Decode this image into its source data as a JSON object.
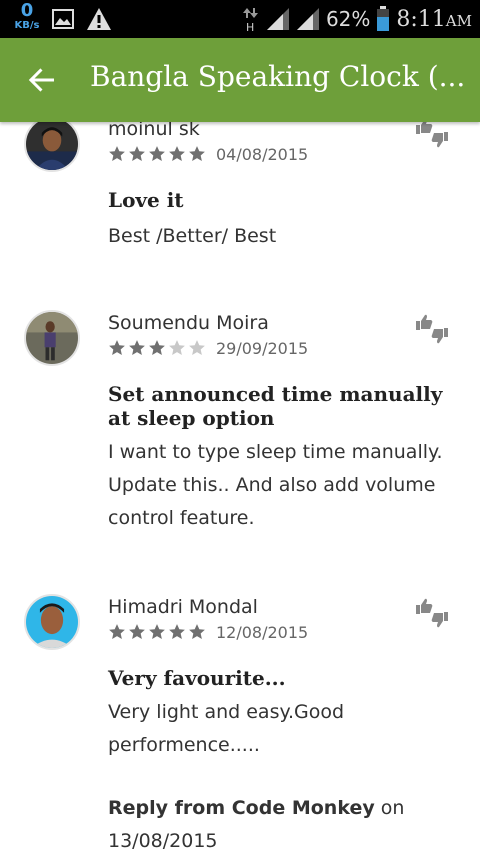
{
  "status_bar": {
    "speed_value": "0",
    "speed_unit": "KB/s",
    "network_type": "H",
    "battery": "62%",
    "time": "8:11",
    "ampm": "AM",
    "icons": [
      "image-icon",
      "warning-icon",
      "data-arrows-icon",
      "signal-icon",
      "signal-icon",
      "battery-icon"
    ]
  },
  "app_bar": {
    "title": "Bangla Speaking Clock (...",
    "color": "#6e9f3a"
  },
  "reviews": [
    {
      "name": "moinul sk",
      "rating": 5,
      "date": "04/08/2015",
      "title": "Love it",
      "body": "Best /Better/ Best"
    },
    {
      "name": "Soumendu Moira",
      "rating": 3,
      "date": "29/09/2015",
      "title": "Set announced time manually at sleep option",
      "body": "I want to type sleep time manually. Update this.. And also add volume control feature."
    },
    {
      "name": "Himadri Mondal",
      "rating": 5,
      "date": "12/08/2015",
      "title": "Very favourite...",
      "body": "Very light and easy.Good performence.....",
      "reply": {
        "from_label": "Reply from Code Monkey",
        "on_label": "on",
        "date": "13/08/2015"
      }
    }
  ],
  "colors": {
    "star_filled": "#707070",
    "star_empty": "#c8c8c8"
  }
}
